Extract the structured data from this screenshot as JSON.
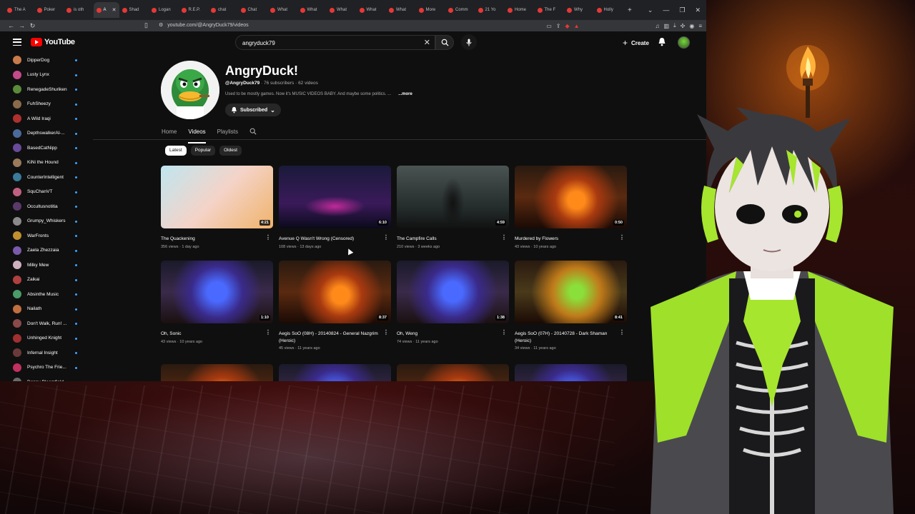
{
  "browser": {
    "tabs": [
      {
        "label": "The A",
        "active": false
      },
      {
        "label": "Poker",
        "active": false
      },
      {
        "label": "is oth",
        "active": false
      },
      {
        "label": "A",
        "active": true
      },
      {
        "label": "Shad",
        "active": false
      },
      {
        "label": "Logan",
        "active": false
      },
      {
        "label": "R.E.P.",
        "active": false
      },
      {
        "label": "chat",
        "active": false
      },
      {
        "label": "Chat",
        "active": false
      },
      {
        "label": "What",
        "active": false
      },
      {
        "label": "What",
        "active": false
      },
      {
        "label": "What",
        "active": false
      },
      {
        "label": "What",
        "active": false
      },
      {
        "label": "What",
        "active": false
      },
      {
        "label": "More",
        "active": false
      },
      {
        "label": "Comm",
        "active": false
      },
      {
        "label": "21 Yo",
        "active": false
      },
      {
        "label": "Home",
        "active": false
      },
      {
        "label": "The F",
        "active": false
      },
      {
        "label": "Why",
        "active": false
      },
      {
        "label": "Holly",
        "active": false
      }
    ],
    "url": "youtube.com/@AngryDuck79/videos"
  },
  "header": {
    "logo_text": "YouTube",
    "search_value": "angryduck79",
    "create_label": "Create"
  },
  "sidebar": {
    "items": [
      {
        "label": "DipperDog",
        "color": "#c97b4a"
      },
      {
        "label": "Lusty Lynx",
        "color": "#c44a8a"
      },
      {
        "label": "RenegadeShuriken",
        "color": "#5a8a3a"
      },
      {
        "label": "FuhSheezy",
        "color": "#8a6a4a"
      },
      {
        "label": "A Wild Iraqi",
        "color": "#b03030"
      },
      {
        "label": "DepthswalkerAl-...",
        "color": "#4a6a9a"
      },
      {
        "label": "BasedCatNipp",
        "color": "#6a4a9a"
      },
      {
        "label": "KiNi the Hound",
        "color": "#9a7a5a"
      },
      {
        "label": "CounterIntelligent",
        "color": "#3a7a9a"
      },
      {
        "label": "SquChanVT",
        "color": "#c06080"
      },
      {
        "label": "Occultusnotitia",
        "color": "#5a3a6a"
      },
      {
        "label": "Grumpy_Whiskers",
        "color": "#8a8a8a"
      },
      {
        "label": "WarFronts",
        "color": "#c09030"
      },
      {
        "label": "Zaela Zhezzaia",
        "color": "#7a5aaa"
      },
      {
        "label": "Milky Mew",
        "color": "#d0b0c0"
      },
      {
        "label": "Zaikai",
        "color": "#b04040"
      },
      {
        "label": "Absinthe Music",
        "color": "#4a9a6a"
      },
      {
        "label": "Nailath",
        "color": "#c07040"
      },
      {
        "label": "Don't Walk, Run! ...",
        "color": "#8a4a4a"
      },
      {
        "label": "Unhinged Knight",
        "color": "#a03030"
      },
      {
        "label": "Infernal Insight",
        "color": "#6a3a3a"
      },
      {
        "label": "Psychro The Frie...",
        "color": "#c03060"
      },
      {
        "label": "Danny Bloomfield",
        "color": "#6a6a6a"
      }
    ]
  },
  "channel": {
    "name": "AngryDuck!",
    "handle": "@AngryDuck79",
    "stats": " · 76 subscribers · 62 videos",
    "description": "Used to be mostly games. Now it's MUSIC VIDEOS BABY. And maybe some politics. ...",
    "more_label": "...more",
    "subscribed_label": "Subscribed"
  },
  "tabs": [
    "Home",
    "Videos",
    "Playlists"
  ],
  "chips": [
    "Latest",
    "Popular",
    "Oldest"
  ],
  "videos": [
    {
      "title": "The Quackening",
      "meta": "356 views · 1 day ago",
      "duration": "4:21",
      "thumb": "anime"
    },
    {
      "title": "Avenue Q Wasn't Wrong (Censored)",
      "meta": "108 views · 13 days ago",
      "duration": "6:10",
      "thumb": "car"
    },
    {
      "title": "The Campfire Calls",
      "meta": "210 views · 3 weeks ago",
      "duration": "4:59",
      "thumb": "forest"
    },
    {
      "title": "Murdered by Flowers",
      "meta": "43 views · 10 years ago",
      "duration": "0:50",
      "thumb": "wow-fire"
    },
    {
      "title": "Oh, Sonic",
      "meta": "43 views · 10 years ago",
      "duration": "1:10",
      "thumb": "wow-blue"
    },
    {
      "title": "Aegis SoO (08H) - 20140824 - General Nazgrim (Heroic)",
      "meta": "45 views · 11 years ago",
      "duration": "8:37",
      "thumb": "wow-fire"
    },
    {
      "title": "Oh, Weng",
      "meta": "74 views · 11 years ago",
      "duration": "1:38",
      "thumb": "wow-blue"
    },
    {
      "title": "Aegis SoO (07H) - 20140728 - Dark Shaman (Heroic)",
      "meta": "34 views · 11 years ago",
      "duration": "8:41",
      "thumb": "wow-green"
    }
  ]
}
